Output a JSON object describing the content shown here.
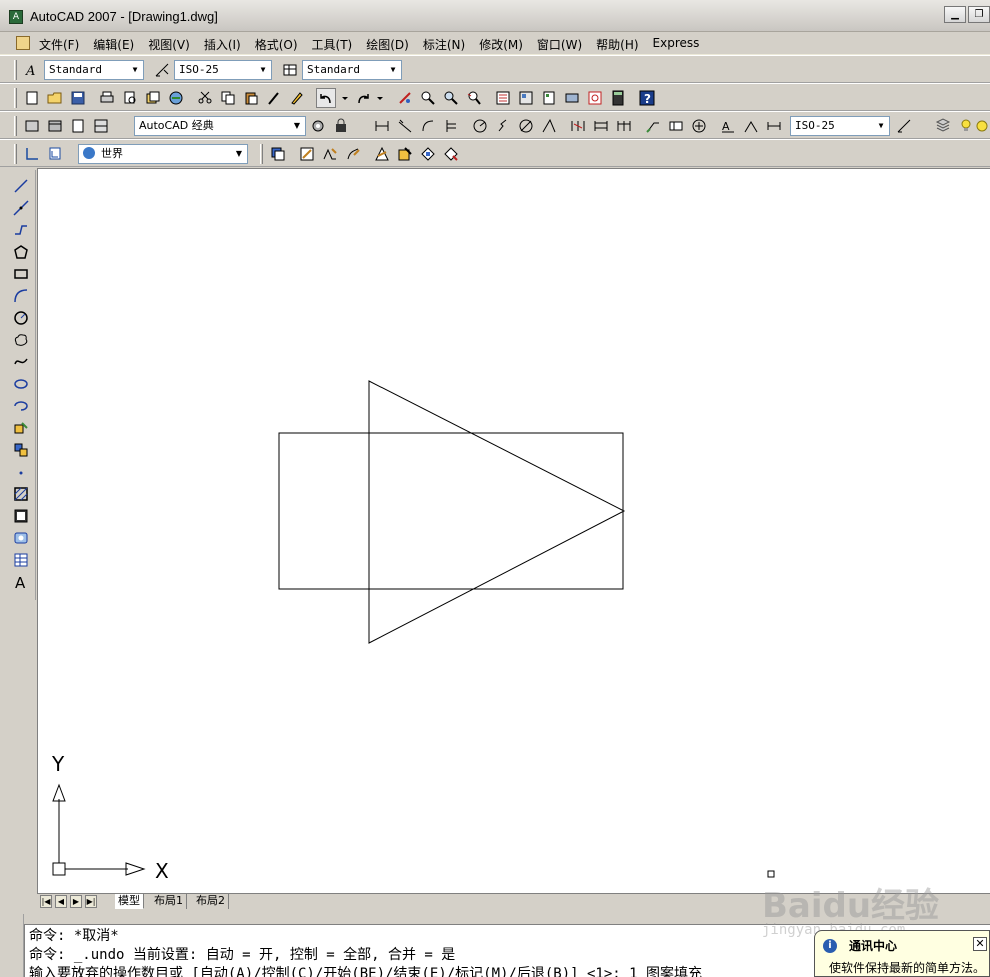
{
  "window": {
    "title": "AutoCAD 2007 - [Drawing1.dwg]",
    "icon": "autocad-app-icon"
  },
  "menu": {
    "items": [
      "文件(F)",
      "编辑(E)",
      "视图(V)",
      "插入(I)",
      "格式(O)",
      "工具(T)",
      "绘图(D)",
      "标注(N)",
      "修改(M)",
      "窗口(W)",
      "帮助(H)",
      "Express"
    ]
  },
  "styles_toolbar": {
    "text_style": "Standard",
    "dim_style": "ISO-25",
    "table_style": "Standard"
  },
  "workspace_toolbar": {
    "workspace": "AutoCAD 经典",
    "dim_style": "ISO-25"
  },
  "ucs_toolbar": {
    "ucs": "世界"
  },
  "ucs_icon": {
    "x_label": "X",
    "y_label": "Y"
  },
  "layout_tabs": [
    "模型",
    "布局1",
    "布局2"
  ],
  "command_window": {
    "lines": [
      "命令: *取消*",
      "命令: _.undo 当前设置: 自动 = 开, 控制 = 全部, 合并 = 是",
      "输入要放弃的操作数目或 [自动(A)/控制(C)/开始(BE)/结束(E)/标记(M)/后退(B)] <1>: 1 图案填充"
    ]
  },
  "notification": {
    "title": "通讯中心",
    "text": "使软件保持最新的简单方法。"
  },
  "watermark": {
    "main": "Baidu经验",
    "sub": "jingyan.baidu.com"
  },
  "colors": {
    "chrome": "#d4d0c8",
    "canvas": "#ffffff",
    "balloon": "#ffffe1"
  }
}
